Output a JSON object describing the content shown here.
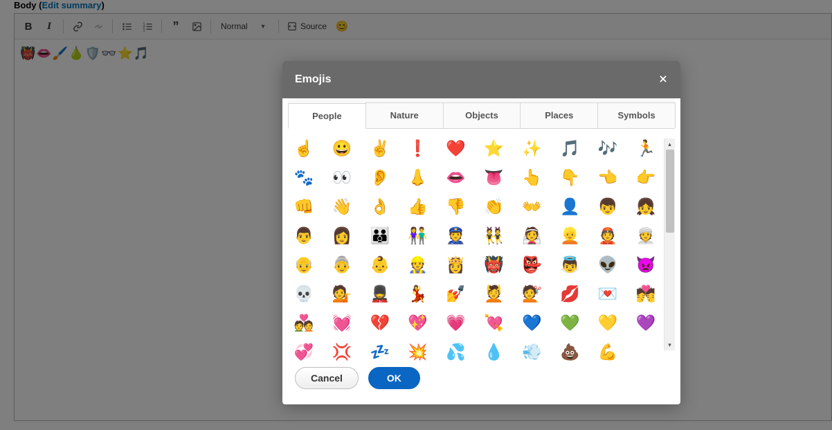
{
  "header": {
    "body_label": "Body",
    "edit_summary_prefix": "(",
    "edit_summary": "Edit summary",
    "edit_summary_suffix": ")"
  },
  "toolbar": {
    "format_label": "Normal",
    "source_label": "Source"
  },
  "editor": {
    "content": "👹👄🖌️🍐🛡️👓⭐🎵"
  },
  "dialog": {
    "title": "Emojis",
    "tabs": {
      "people": "People",
      "nature": "Nature",
      "objects": "Objects",
      "places": "Places",
      "symbols": "Symbols"
    },
    "active_tab": "people",
    "cancel_label": "Cancel",
    "ok_label": "OK"
  },
  "emojis": {
    "people": [
      "☝️",
      "😀",
      "✌️",
      "❗",
      "❤️",
      "⭐",
      "✨",
      "🎵",
      "🎶",
      "🏃",
      "🐾",
      "👀",
      "👂",
      "👃",
      "👄",
      "👅",
      "👆",
      "👇",
      "👈",
      "👉",
      "👊",
      "👋",
      "👌",
      "👍",
      "👎",
      "👏",
      "👐",
      "👤",
      "👦",
      "👧",
      "👨",
      "👩",
      "👪",
      "👫",
      "👮",
      "👯",
      "👰",
      "👱",
      "👲",
      "👳",
      "👴",
      "👵",
      "👶",
      "👷",
      "👸",
      "👹",
      "👺",
      "👼",
      "👽",
      "👿",
      "💀",
      "💁",
      "💂",
      "💃",
      "💅",
      "💆",
      "💇",
      "💋",
      "💌",
      "💏",
      "💑",
      "💓",
      "💔",
      "💖",
      "💗",
      "💘",
      "💙",
      "💚",
      "💛",
      "💜",
      "💞",
      "💢",
      "💤",
      "💥",
      "💦",
      "💧",
      "💨",
      "💩",
      "💪"
    ]
  }
}
